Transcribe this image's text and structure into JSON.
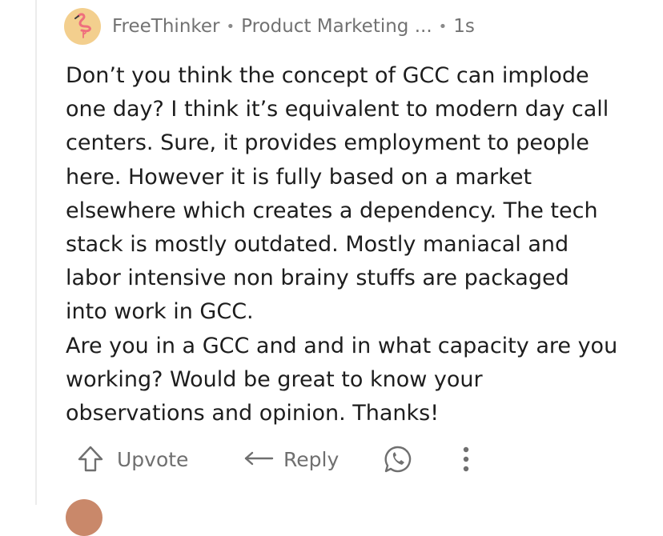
{
  "comment": {
    "author": "FreeThinker",
    "separator_1": "•",
    "role": "Product Marketing ...",
    "separator_2": "•",
    "time": "1s",
    "body": "Don’t you think the concept of GCC can implode\none day? I think it’s equivalent to modern day call\ncenters. Sure, it provides employment to people\nhere. However it is fully based on a market\nelsewhere which creates a dependency. The tech\nstack is mostly outdated. Mostly maniacal and\nlabor intensive non brainy stuffs are packaged\ninto work in GCC.\nAre you in a GCC and and in what capacity are you\nworking? Would be great to know your\nobservations and opinion. Thanks!"
  },
  "actions": {
    "upvote_label": "Upvote",
    "reply_label": "Reply"
  },
  "icons": {
    "avatar": "flamingo-icon",
    "upvote": "up-arrow-icon",
    "reply": "reply-arrow-icon",
    "share": "whatsapp-icon",
    "more": "more-vertical-icon"
  },
  "colors": {
    "avatar_bg": "#f3cf8e",
    "flamingo": "#ef6f7d",
    "meta_text": "#727272",
    "body_text": "#1d1d1d",
    "action_text": "#6f6f6f"
  }
}
